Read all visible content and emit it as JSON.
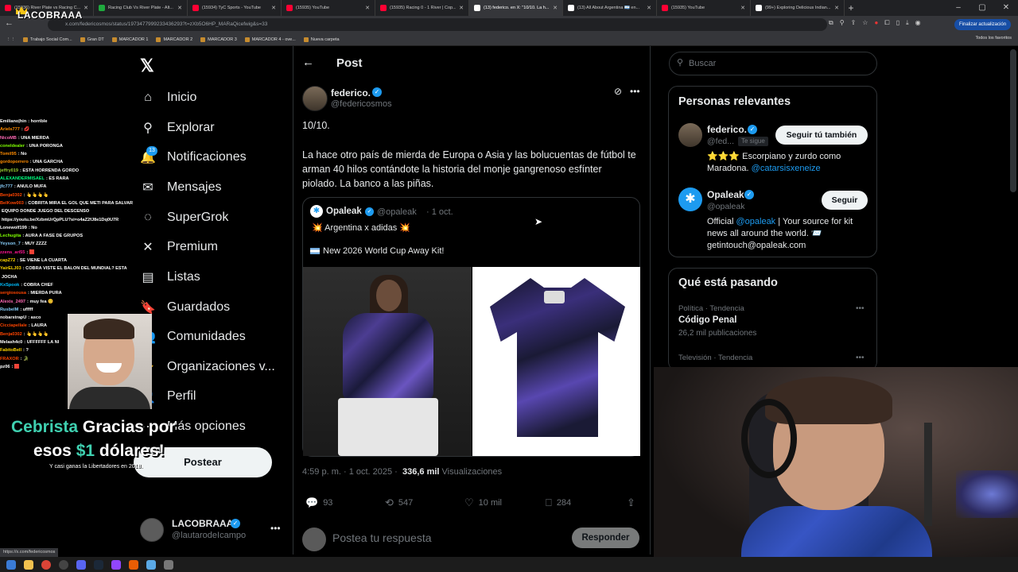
{
  "browser": {
    "tabs": [
      {
        "title": "(15936) River Plate vs Racing C...",
        "color": "#ff0033",
        "active": false
      },
      {
        "title": "Racing Club Vs River Plate - Alt...",
        "color": "#1faa3e",
        "active": false
      },
      {
        "title": "(15934) TyC Sports - YouTube",
        "color": "#ff0033",
        "active": false
      },
      {
        "title": "(15935) YouTube",
        "color": "#ff0033",
        "active": false
      },
      {
        "title": "(15935) Racing 0 - 1 River | Cop...",
        "color": "#ff0033",
        "active": false
      },
      {
        "title": "(13) federico. en X: \"10/10. La h...",
        "color": "#ffffff",
        "active": true
      },
      {
        "title": "(13) All About Argentina 🇦🇷 en...",
        "color": "#ffffff",
        "active": false
      },
      {
        "title": "(15935) YouTube",
        "color": "#ff0033",
        "active": false
      },
      {
        "title": "(99+) Exploring Delicious Indian...",
        "color": "#ffffff",
        "active": false
      }
    ],
    "new_tab": "+",
    "url": "x.com/federicosmos/status/1973477999233436293?t=zXb5O6HP_MARaQicefwig&s=33",
    "update_button": "Finalizar actualización",
    "bookmarks": [
      "Trabajo Social Com...",
      "Gran DT",
      "MARCADOR 1",
      "MARCADOR 2",
      "MARCADOR 3",
      "MARCADOR 4 - ove...",
      "Nueva carpeta"
    ],
    "all_bookmarks": "Todos los favoritos",
    "status_url": "https://x.com/federicosmos"
  },
  "stream": {
    "channel_logo": "LACOBRAAA",
    "chat": [
      {
        "user": "Emiliano|hin",
        "msg": ": horrible",
        "color": "#ffffff"
      },
      {
        "user": "Ariels777",
        "msg": ": 💋",
        "color": "#ff8c00"
      },
      {
        "user": "NicoMB",
        "msg": ": UNA MIERDA",
        "color": "#ff69b4"
      },
      {
        "user": "coneldealer",
        "msg": ": UNA PORONGA",
        "color": "#7fff00"
      },
      {
        "user": "Tomil95",
        "msg": ": No",
        "color": "#ff8c00"
      },
      {
        "user": "gordoporrero",
        "msg": ": UNA GARCHA",
        "color": "#ff8c00"
      },
      {
        "user": "jeffry019",
        "msg": ": ESTA HORRENDA GORDO",
        "color": "#9acd32"
      },
      {
        "user": "ALEXANDERMISAEL",
        "msg": ": ES RARA",
        "color": "#00ff7f"
      },
      {
        "user": "jfc777",
        "msg": ": ANULO MUFA",
        "color": "#87cefa"
      },
      {
        "user": "Benja0302",
        "msg": ": 👆👆👆👆",
        "color": "#ff4500"
      },
      {
        "user": "BelKow003",
        "msg": ": COBRITA MIRA EL GOL QUE METI PARA SALVAR",
        "color": "#ff4500"
      },
      {
        "user": "",
        "msg": "EQUIPO DONDE JUEGO DEL DESCENSO",
        "color": "#ffffff"
      },
      {
        "user": "",
        "msg": "https://youtu.be/XzbmUrQpPLU?si=o4aZ2fJ8e1Dq0U7R",
        "color": "#ffffff"
      },
      {
        "user": "Lonewolf199",
        "msg": ": No",
        "color": "#ffffff"
      },
      {
        "user": "Lechugita",
        "msg": ": AURA A FASE DE GRUPOS",
        "color": "#7fff00"
      },
      {
        "user": "Yeyson_7",
        "msg": ": MUY ZZZZ",
        "color": "#87cefa"
      },
      {
        "user": "zzens_ari55",
        "msg": ": 🟥",
        "color": "#ff1493"
      },
      {
        "user": "capZ72",
        "msg": ": SE VIENE LA CUARTA",
        "color": "#ffd700"
      },
      {
        "user": "YairELJ03",
        "msg": ": COBRA VISTE EL BALON DEL MUNDIAL? ESTA",
        "color": "#ffd700"
      },
      {
        "user": "",
        "msg": "JOCHA",
        "color": "#ffffff"
      },
      {
        "user": "KxSpook",
        "msg": ": COBRA CHEF",
        "color": "#00bfff"
      },
      {
        "user": "sergiosousa",
        "msg": ": MIERDA PURA",
        "color": "#ff4500"
      },
      {
        "user": "Alexis_2497",
        "msg": ": muy fea 😊",
        "color": "#ff69b4"
      },
      {
        "user": "RusbelM",
        "msg": ": ufffff",
        "color": "#87cefa"
      },
      {
        "user": "nobarstrapU",
        "msg": ": asco",
        "color": "#ffffff"
      },
      {
        "user": "Cicciapellale",
        "msg": ": LAURA",
        "color": "#ff4500"
      },
      {
        "user": "Benja0302",
        "msg": ": 👆👆👆👆",
        "color": "#ff4500"
      },
      {
        "user": "Melash4c0",
        "msg": ": UFFFFFF LA NI",
        "color": "#ffffff"
      },
      {
        "user": "FabitoBell",
        "msg": ": ?",
        "color": "#ffd700"
      },
      {
        "user": "FRAXOR",
        "msg": ": 🐊",
        "color": "#ff4500"
      },
      {
        "user": "pz06",
        "msg": ": 🟥",
        "color": "#ffffff"
      }
    ],
    "alert_name": "Cebrista",
    "alert_thanks": "Gracias por",
    "alert_line2_a": "esos",
    "alert_amount": "$1",
    "alert_line2_b": "dólares!",
    "alert_sub": "Y casi ganas la Libertadores en 2018."
  },
  "x_nav": {
    "logo": "𝕏",
    "items": [
      {
        "label": "Inicio",
        "icon": "home-icon",
        "glyph": "⌂"
      },
      {
        "label": "Explorar",
        "icon": "search-icon",
        "glyph": "⚲"
      },
      {
        "label": "Notificaciones",
        "icon": "bell-icon",
        "glyph": "🔔"
      },
      {
        "label": "Mensajes",
        "icon": "mail-icon",
        "glyph": "✉"
      },
      {
        "label": "SuperGrok",
        "icon": "grok-icon",
        "glyph": "◌"
      },
      {
        "label": "Premium",
        "icon": "x-premium-icon",
        "glyph": "✕"
      },
      {
        "label": "Listas",
        "icon": "list-icon",
        "glyph": "▤"
      },
      {
        "label": "Guardados",
        "icon": "bookmark-icon",
        "glyph": "🔖"
      },
      {
        "label": "Comunidades",
        "icon": "communities-icon",
        "glyph": "👥"
      },
      {
        "label": "Organizaciones v...",
        "icon": "verified-org-icon",
        "glyph": "⚡"
      },
      {
        "label": "Perfil",
        "icon": "profile-icon",
        "glyph": "👤"
      },
      {
        "label": "Más opciones",
        "icon": "more-options-icon",
        "glyph": "⋯"
      }
    ],
    "notif_badge": "13",
    "post_button": "Postear",
    "account_name": "LACOBRAAA",
    "account_handle": "@lautarodeIcampo"
  },
  "post": {
    "header": "Post",
    "author_name": "federico.",
    "author_handle": "@federicosmos",
    "text_line1": "10/10.",
    "text_line2": "La hace otro país de mierda de Europa o Asia y las bolucuentas de fútbol te arman 40 hilos contándote la historia del monje gangrenoso esfínter piolado. La banco a las piñas.",
    "quote": {
      "author_name": "Opaleak",
      "author_handle": "@opaleak",
      "date": "· 1 oct.",
      "line1": "💥 Argentina x adidas 💥",
      "line2": "New 2026 World Cup Away Kit!"
    },
    "timestamp": "4:59 p. m. · 1 oct. 2025 ·",
    "views_count": "336,6 mil",
    "views_label": "Visualizaciones",
    "replies": "93",
    "reposts": "547",
    "likes": "10 mil",
    "bookmarks": "284",
    "reply_placeholder": "Postea tu respuesta",
    "reply_button": "Responder"
  },
  "sidebar": {
    "search_placeholder": "Buscar",
    "relevant_header": "Personas relevantes",
    "person1": {
      "name": "federico.",
      "handle": "@fed...",
      "tag": "Te sigue",
      "button": "Seguir tú también",
      "bio_text": "⭐⭐⭐ Escorpiano y zurdo como Maradona.",
      "bio_link": "@catarsisxeneize"
    },
    "person2": {
      "name": "Opaleak",
      "handle": "@opaleak",
      "button": "Seguir",
      "bio_a": "Official",
      "bio_link": "@opaleak",
      "bio_b": "| Your source for kit news all around the world. 📨 getintouch@opaleak.com"
    },
    "trends_header": "Qué está pasando",
    "trend1": {
      "category": "Política · Tendencia",
      "name": "Código Penal",
      "count": "26,2 mil publicaciones"
    },
    "trend2": {
      "category": "Televisión · Tendencia"
    }
  }
}
